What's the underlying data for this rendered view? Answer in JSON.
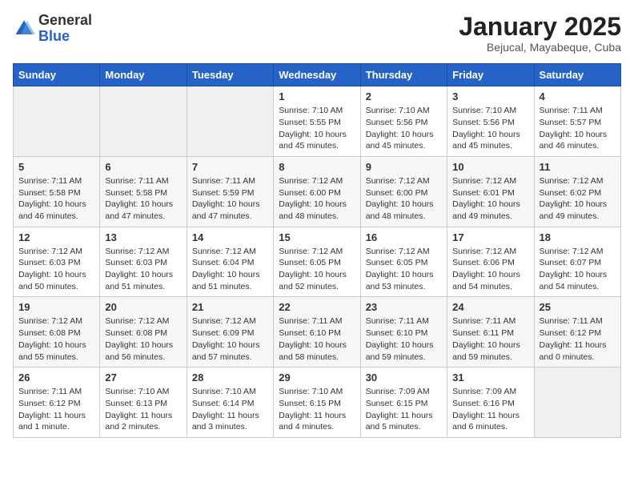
{
  "logo": {
    "general": "General",
    "blue": "Blue"
  },
  "title": "January 2025",
  "subtitle": "Bejucal, Mayabeque, Cuba",
  "weekdays": [
    "Sunday",
    "Monday",
    "Tuesday",
    "Wednesday",
    "Thursday",
    "Friday",
    "Saturday"
  ],
  "weeks": [
    [
      {
        "day": "",
        "info": ""
      },
      {
        "day": "",
        "info": ""
      },
      {
        "day": "",
        "info": ""
      },
      {
        "day": "1",
        "info": "Sunrise: 7:10 AM\nSunset: 5:55 PM\nDaylight: 10 hours\nand 45 minutes."
      },
      {
        "day": "2",
        "info": "Sunrise: 7:10 AM\nSunset: 5:56 PM\nDaylight: 10 hours\nand 45 minutes."
      },
      {
        "day": "3",
        "info": "Sunrise: 7:10 AM\nSunset: 5:56 PM\nDaylight: 10 hours\nand 45 minutes."
      },
      {
        "day": "4",
        "info": "Sunrise: 7:11 AM\nSunset: 5:57 PM\nDaylight: 10 hours\nand 46 minutes."
      }
    ],
    [
      {
        "day": "5",
        "info": "Sunrise: 7:11 AM\nSunset: 5:58 PM\nDaylight: 10 hours\nand 46 minutes."
      },
      {
        "day": "6",
        "info": "Sunrise: 7:11 AM\nSunset: 5:58 PM\nDaylight: 10 hours\nand 47 minutes."
      },
      {
        "day": "7",
        "info": "Sunrise: 7:11 AM\nSunset: 5:59 PM\nDaylight: 10 hours\nand 47 minutes."
      },
      {
        "day": "8",
        "info": "Sunrise: 7:12 AM\nSunset: 6:00 PM\nDaylight: 10 hours\nand 48 minutes."
      },
      {
        "day": "9",
        "info": "Sunrise: 7:12 AM\nSunset: 6:00 PM\nDaylight: 10 hours\nand 48 minutes."
      },
      {
        "day": "10",
        "info": "Sunrise: 7:12 AM\nSunset: 6:01 PM\nDaylight: 10 hours\nand 49 minutes."
      },
      {
        "day": "11",
        "info": "Sunrise: 7:12 AM\nSunset: 6:02 PM\nDaylight: 10 hours\nand 49 minutes."
      }
    ],
    [
      {
        "day": "12",
        "info": "Sunrise: 7:12 AM\nSunset: 6:03 PM\nDaylight: 10 hours\nand 50 minutes."
      },
      {
        "day": "13",
        "info": "Sunrise: 7:12 AM\nSunset: 6:03 PM\nDaylight: 10 hours\nand 51 minutes."
      },
      {
        "day": "14",
        "info": "Sunrise: 7:12 AM\nSunset: 6:04 PM\nDaylight: 10 hours\nand 51 minutes."
      },
      {
        "day": "15",
        "info": "Sunrise: 7:12 AM\nSunset: 6:05 PM\nDaylight: 10 hours\nand 52 minutes."
      },
      {
        "day": "16",
        "info": "Sunrise: 7:12 AM\nSunset: 6:05 PM\nDaylight: 10 hours\nand 53 minutes."
      },
      {
        "day": "17",
        "info": "Sunrise: 7:12 AM\nSunset: 6:06 PM\nDaylight: 10 hours\nand 54 minutes."
      },
      {
        "day": "18",
        "info": "Sunrise: 7:12 AM\nSunset: 6:07 PM\nDaylight: 10 hours\nand 54 minutes."
      }
    ],
    [
      {
        "day": "19",
        "info": "Sunrise: 7:12 AM\nSunset: 6:08 PM\nDaylight: 10 hours\nand 55 minutes."
      },
      {
        "day": "20",
        "info": "Sunrise: 7:12 AM\nSunset: 6:08 PM\nDaylight: 10 hours\nand 56 minutes."
      },
      {
        "day": "21",
        "info": "Sunrise: 7:12 AM\nSunset: 6:09 PM\nDaylight: 10 hours\nand 57 minutes."
      },
      {
        "day": "22",
        "info": "Sunrise: 7:11 AM\nSunset: 6:10 PM\nDaylight: 10 hours\nand 58 minutes."
      },
      {
        "day": "23",
        "info": "Sunrise: 7:11 AM\nSunset: 6:10 PM\nDaylight: 10 hours\nand 59 minutes."
      },
      {
        "day": "24",
        "info": "Sunrise: 7:11 AM\nSunset: 6:11 PM\nDaylight: 10 hours\nand 59 minutes."
      },
      {
        "day": "25",
        "info": "Sunrise: 7:11 AM\nSunset: 6:12 PM\nDaylight: 11 hours\nand 0 minutes."
      }
    ],
    [
      {
        "day": "26",
        "info": "Sunrise: 7:11 AM\nSunset: 6:12 PM\nDaylight: 11 hours\nand 1 minute."
      },
      {
        "day": "27",
        "info": "Sunrise: 7:10 AM\nSunset: 6:13 PM\nDaylight: 11 hours\nand 2 minutes."
      },
      {
        "day": "28",
        "info": "Sunrise: 7:10 AM\nSunset: 6:14 PM\nDaylight: 11 hours\nand 3 minutes."
      },
      {
        "day": "29",
        "info": "Sunrise: 7:10 AM\nSunset: 6:15 PM\nDaylight: 11 hours\nand 4 minutes."
      },
      {
        "day": "30",
        "info": "Sunrise: 7:09 AM\nSunset: 6:15 PM\nDaylight: 11 hours\nand 5 minutes."
      },
      {
        "day": "31",
        "info": "Sunrise: 7:09 AM\nSunset: 6:16 PM\nDaylight: 11 hours\nand 6 minutes."
      },
      {
        "day": "",
        "info": ""
      }
    ]
  ]
}
